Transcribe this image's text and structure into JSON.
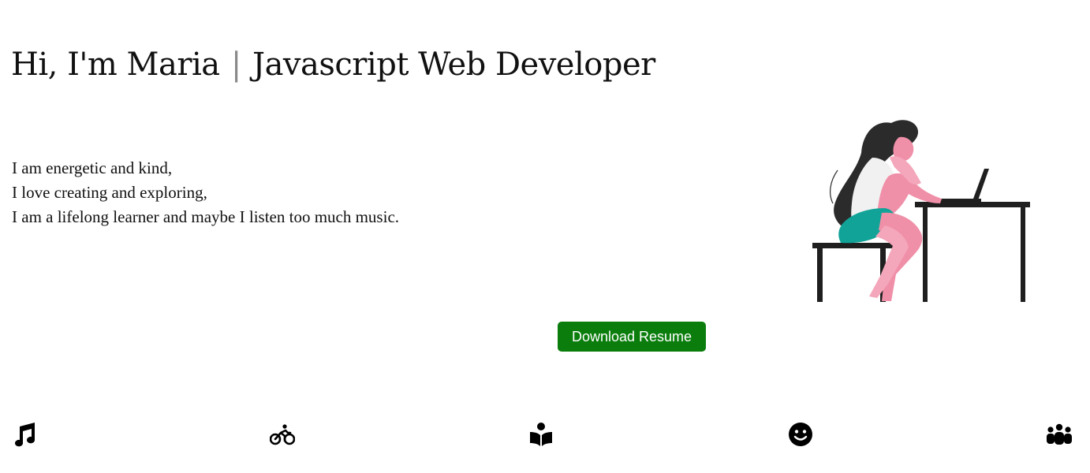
{
  "hero": {
    "title_name": "Hi, I'm Maria",
    "title_divider": "|",
    "title_role": "Javascript Web Developer"
  },
  "bio": {
    "lines": [
      "I am energetic and kind,",
      "I love creating and exploring,",
      "I am a lifelong learner and maybe I listen too much music."
    ]
  },
  "actions": {
    "download_label": "Download Resume",
    "button_color": "#0a7d0c"
  },
  "illustration": {
    "icon": "woman-at-laptop-illustration",
    "colors": {
      "hair": "#2b2b2b",
      "skin": "#f08fa8",
      "shorts": "#12a398",
      "shirt": "#f1f1f1",
      "furniture": "#1f1f1f"
    }
  },
  "hobbies": [
    {
      "icon": "music-note-icon"
    },
    {
      "icon": "bicycle-icon"
    },
    {
      "icon": "reading-icon"
    },
    {
      "icon": "smile-icon"
    },
    {
      "icon": "people-group-icon"
    }
  ]
}
